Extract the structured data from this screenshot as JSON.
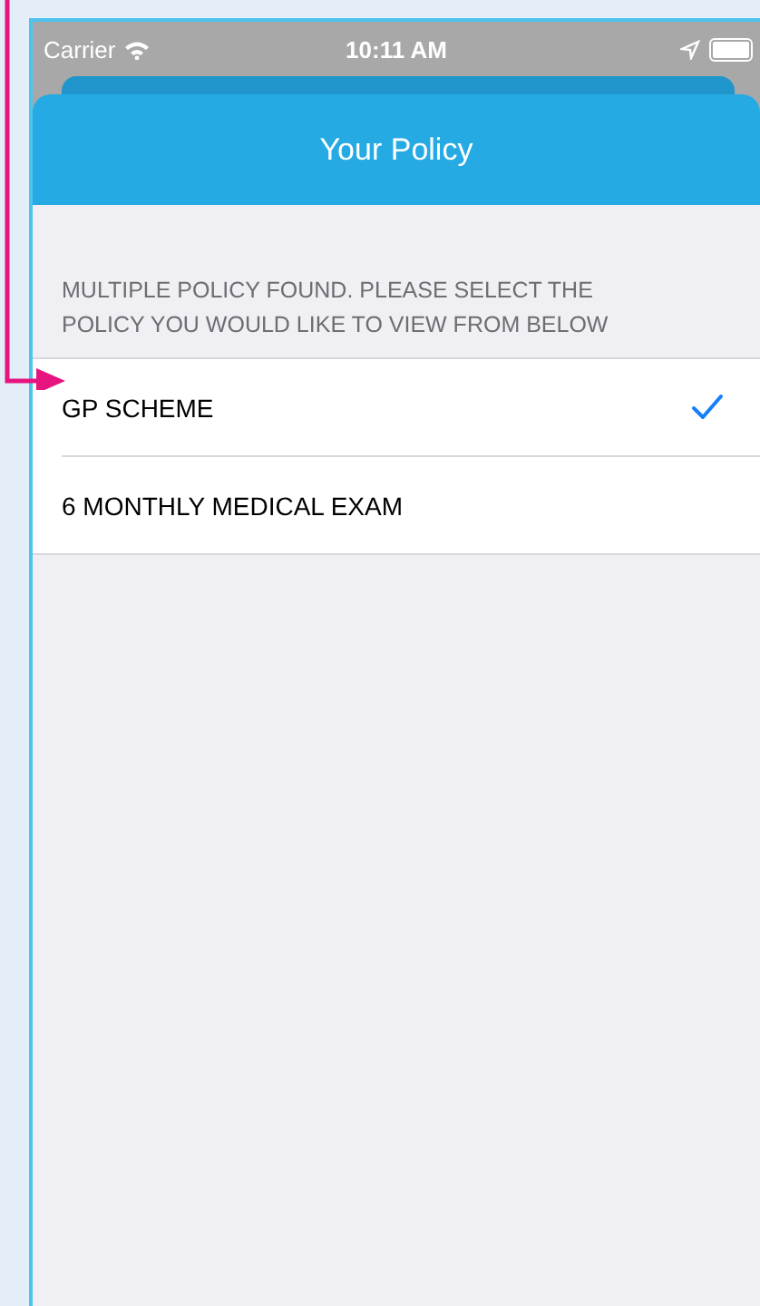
{
  "status_bar": {
    "carrier": "Carrier",
    "time": "10:11 AM"
  },
  "header": {
    "title": "Your Policy"
  },
  "section_header": "MULTIPLE POLICY FOUND. PLEASE SELECT THE POLICY YOU WOULD LIKE TO VIEW FROM BELOW",
  "policies": [
    {
      "label": "GP SCHEME",
      "selected": true
    },
    {
      "label": "6 MONTHLY MEDICAL EXAM",
      "selected": false
    }
  ]
}
